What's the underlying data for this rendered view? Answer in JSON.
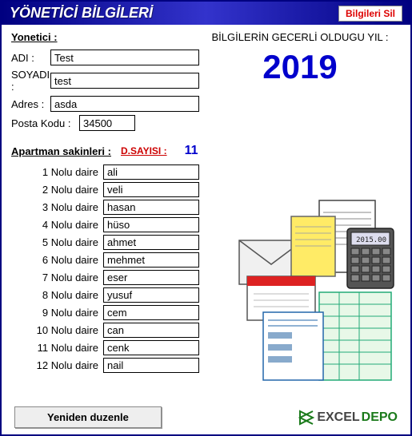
{
  "header": {
    "title": "YÖNETİCİ  BİLGİLERİ",
    "delete_button": "Bilgileri Sil"
  },
  "manager": {
    "section_label": "Yonetici :",
    "name_label": "ADI :",
    "name_value": "Test",
    "surname_label": "SOYADI :",
    "surname_value": "test",
    "address_label": "Adres :",
    "address_value": "asda",
    "postal_label": "Posta Kodu :",
    "postal_value": "34500"
  },
  "year": {
    "label": "BİLGİLERİN GECERLİ OLDUGU YIL :",
    "value": "2019"
  },
  "residents": {
    "section_label": "Apartman sakinleri :",
    "dsayisi_label": "D.SAYISI  :",
    "dsayisi_value": "11"
  },
  "daire_label_prefix": "Nolu daire",
  "daires": [
    {
      "num": "1",
      "name": "ali"
    },
    {
      "num": "2",
      "name": "veli"
    },
    {
      "num": "3",
      "name": "hasan"
    },
    {
      "num": "4",
      "name": "hüso"
    },
    {
      "num": "5",
      "name": "ahmet"
    },
    {
      "num": "6",
      "name": "mehmet"
    },
    {
      "num": "7",
      "name": "eser"
    },
    {
      "num": "8",
      "name": "yusuf"
    },
    {
      "num": "9",
      "name": "cem"
    },
    {
      "num": "10",
      "name": "can"
    },
    {
      "num": "11",
      "name": "cenk"
    },
    {
      "num": "12",
      "name": "nail"
    }
  ],
  "footer": {
    "reorder_button": "Yeniden duzenle",
    "brand_excel": "EXCEL",
    "brand_depo": "DEPO"
  }
}
